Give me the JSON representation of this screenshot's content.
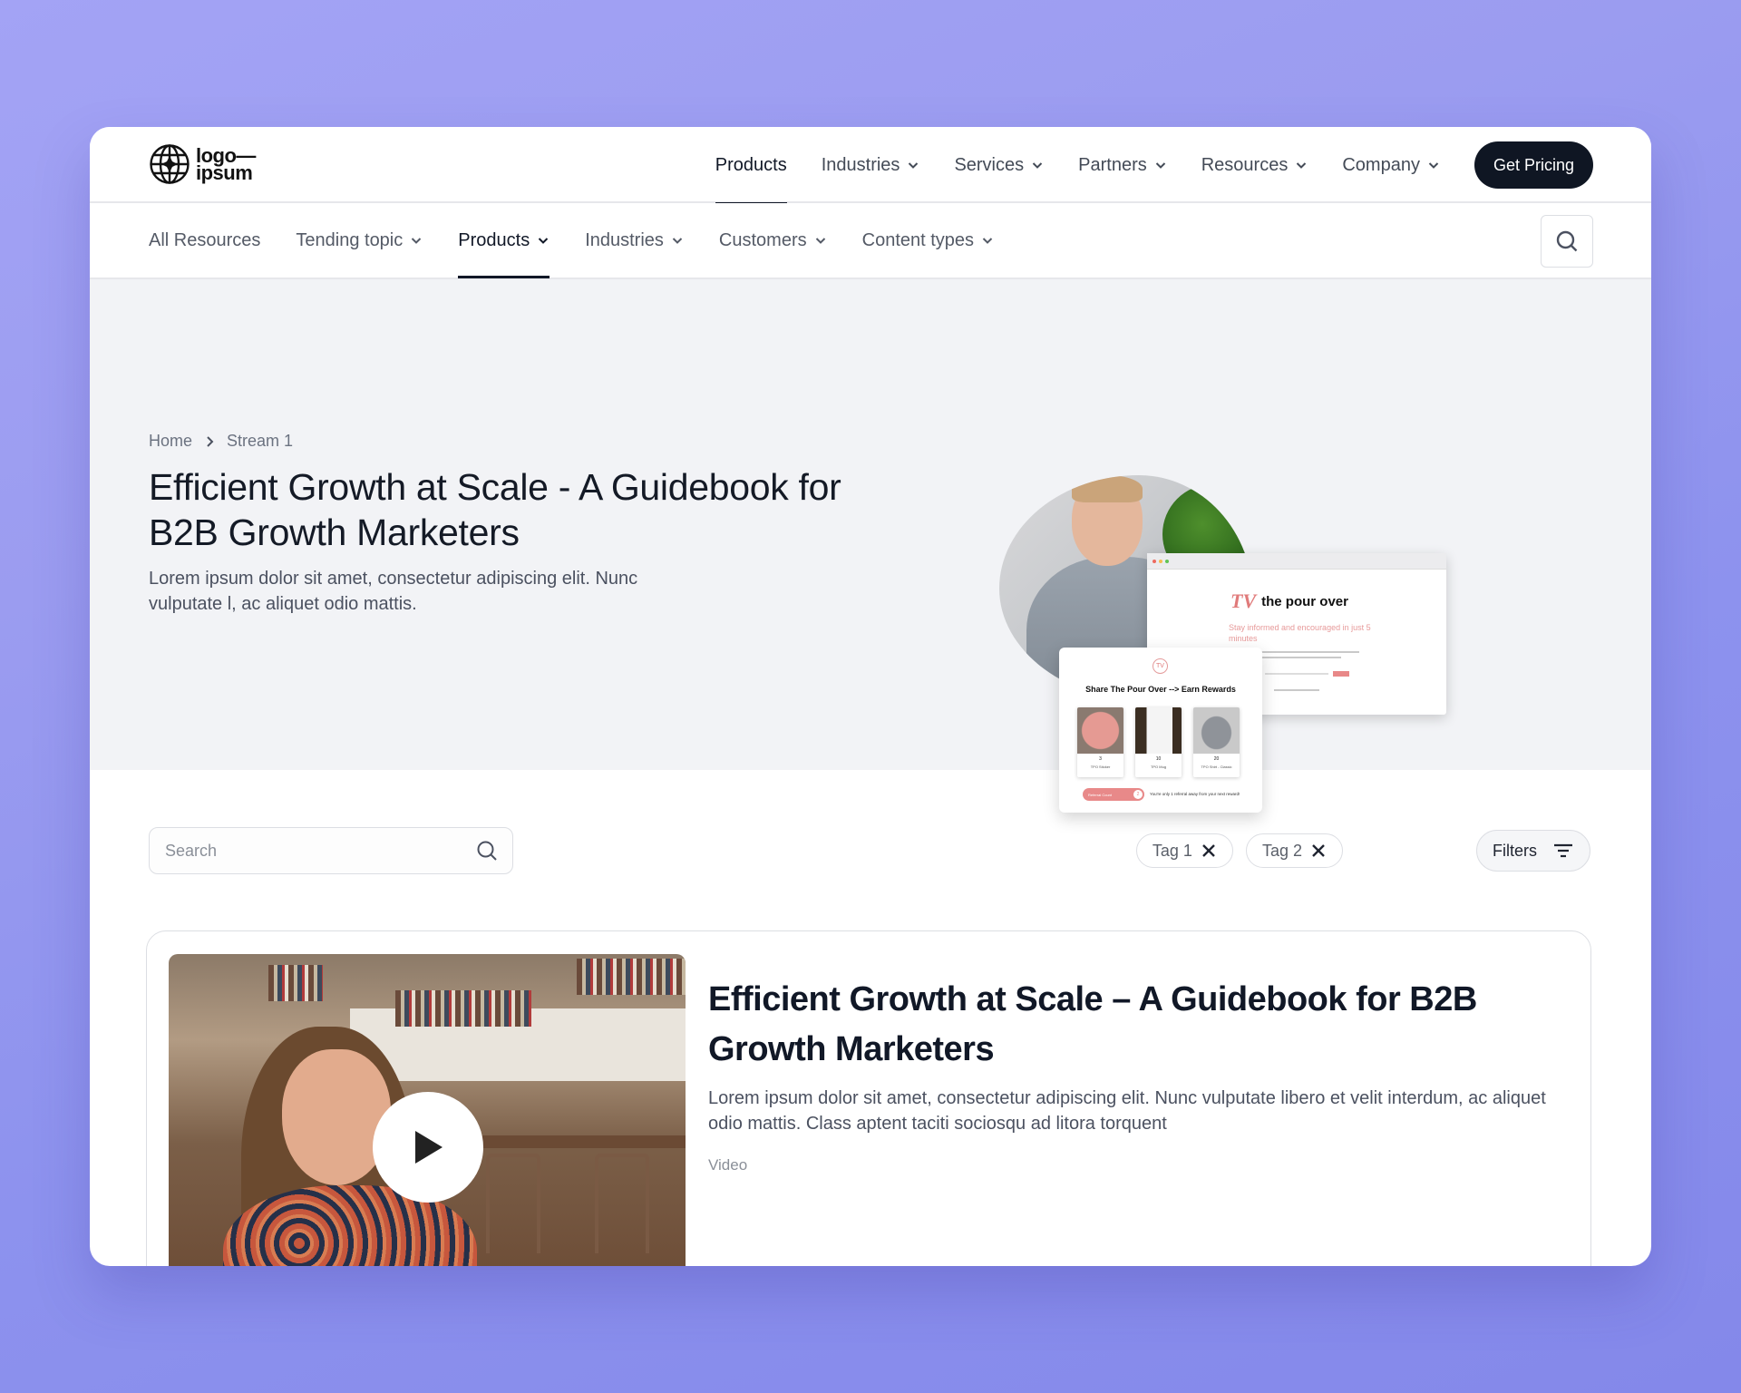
{
  "logo": {
    "line1": "logo—",
    "line2": "ipsum"
  },
  "top_nav": {
    "items": [
      {
        "label": "Products",
        "active": true,
        "dropdown": false
      },
      {
        "label": "Industries",
        "dropdown": true
      },
      {
        "label": "Services",
        "dropdown": true
      },
      {
        "label": "Partners",
        "dropdown": true
      },
      {
        "label": "Resources",
        "dropdown": true
      },
      {
        "label": "Company",
        "dropdown": true
      }
    ],
    "cta_label": "Get Pricing"
  },
  "sub_nav": {
    "items": [
      {
        "label": "All Resources",
        "dropdown": false
      },
      {
        "label": "Tending topic",
        "dropdown": true
      },
      {
        "label": "Products",
        "dropdown": true,
        "active": true
      },
      {
        "label": "Industries",
        "dropdown": true
      },
      {
        "label": "Customers",
        "dropdown": true
      },
      {
        "label": "Content types",
        "dropdown": true
      }
    ],
    "search_icon": "search-icon"
  },
  "hero": {
    "breadcrumb": [
      "Home",
      "Stream 1"
    ],
    "title": "Efficient Growth at Scale - A Guidebook for B2B Growth Marketers",
    "description": "Lorem ipsum dolor sit amet, consectetur adipiscing elit. Nunc vulputate l, ac aliquet odio mattis.",
    "mockup": {
      "brand": "the pour over",
      "brand_mark": "TV",
      "tagline": "Stay informed and encouraged in just 5 minutes",
      "share_title": "Share The Pour Over --> Earn Rewards",
      "rewards": [
        {
          "count": "3",
          "name": "TPO Sticker"
        },
        {
          "count": "10",
          "name": "TPO Mug"
        },
        {
          "count": "20",
          "name": "TPO Shirt - Classic"
        }
      ],
      "referral_label": "Referral Count",
      "referral_count": "2",
      "referral_text": "You're only 1 referral away from your next reward!"
    }
  },
  "filters": {
    "search_placeholder": "Search",
    "search_value": "",
    "tags": [
      "Tag 1",
      "Tag 2"
    ],
    "filters_label": "Filters"
  },
  "results": [
    {
      "title": "Efficient Growth at Scale – A Guidebook for B2B Growth Marketers",
      "description": "Lorem ipsum dolor sit amet, consectetur adipiscing elit. Nunc vulputate libero et velit interdum, ac aliquet odio mattis. Class aptent taciti sociosqu ad litora torquent",
      "type": "Video",
      "media_icon": "play-icon"
    }
  ],
  "colors": {
    "primary_dark": "#0f1623",
    "accent_pink": "#e07a7a",
    "background_gradient": "#9b9cf0"
  }
}
